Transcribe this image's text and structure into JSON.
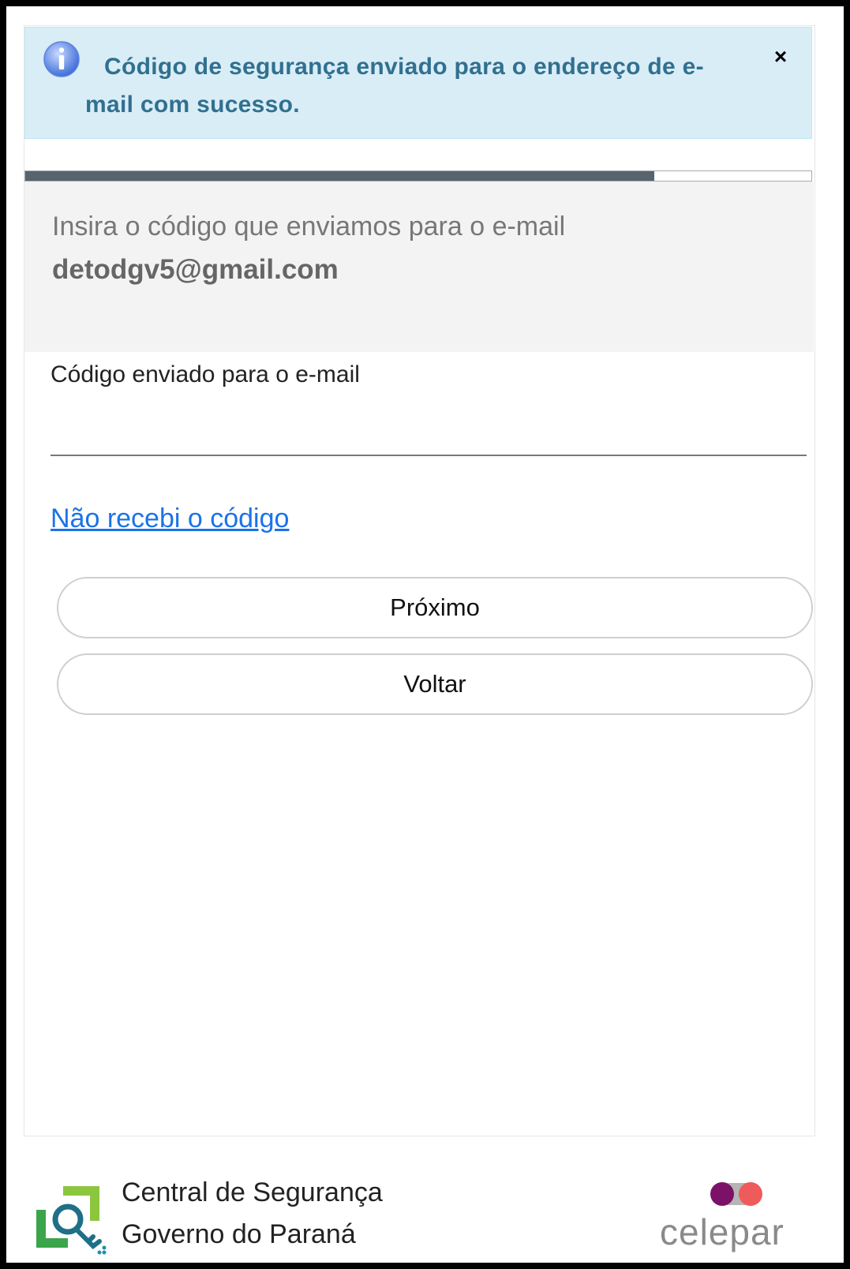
{
  "alert": {
    "message": "Código de segurança enviado para o endereço de e-mail com sucesso.",
    "close_label": "×",
    "icon": "info-icon",
    "color": "#31708f",
    "background": "#d9edf7"
  },
  "progress": {
    "value": 0.8,
    "fill_color": "#56646f"
  },
  "instructions": {
    "text": "Insira o código que enviamos para o e-mail",
    "email": "detodgv5@gmail.com"
  },
  "form": {
    "code_label": "Código enviado para o e-mail",
    "code_value": "",
    "resend_link": "Não recebi o código",
    "next_button": "Próximo",
    "back_button": "Voltar"
  },
  "footer": {
    "title_line1": "Central de Segurança",
    "title_line2": "Governo do Paraná",
    "partner_logo_text": "celepar",
    "partner_colors": [
      "#7b1268",
      "#ef5a5a"
    ]
  }
}
